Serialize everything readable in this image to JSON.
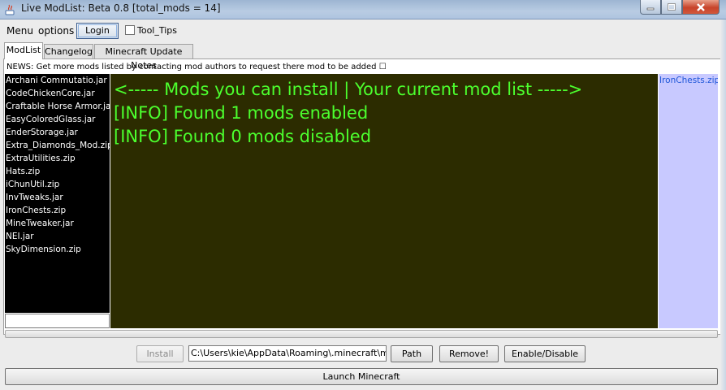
{
  "window": {
    "title": "Live ModList: Beta 0.8 [total_mods = 14]"
  },
  "menubar": {
    "menu_label": "Menu",
    "options_label": "options",
    "login_label": "Login",
    "tooltips_label": "Tool_Tips",
    "tooltips_checked": false
  },
  "tabs": [
    {
      "label": "ModList",
      "active": true
    },
    {
      "label": "Changelog",
      "active": false
    },
    {
      "label": "Minecraft Update Notes",
      "active": false
    }
  ],
  "news": {
    "text": "NEWS: Get more mods listed by contacting mod authors to request there mod to be added ☐"
  },
  "available_mods": [
    "Archani Commutatio.jar",
    "CodeChickenCore.jar",
    "Craftable Horse Armor.jar",
    "EasyColoredGlass.jar",
    "EnderStorage.jar",
    "Extra_Diamonds_Mod.zip",
    "ExtraUtilities.zip",
    "Hats.zip",
    "iChunUtil.zip",
    "InvTweaks.jar",
    "IronChests.zip",
    "MineTweaker.jar",
    "NEI.jar",
    "SkyDimension.zip"
  ],
  "filter_input": {
    "value": ""
  },
  "console": {
    "lines": [
      "<----- Mods you can install | Your current mod list ----->",
      "[INFO] Found 1 mods enabled",
      "[INFO] Found 0 mods disabled"
    ],
    "text_color": "#4cff2e",
    "background_color": "#2c2c00"
  },
  "installed_mods": [
    "IronChests.zip"
  ],
  "controls": {
    "install_label": "Install",
    "install_enabled": false,
    "path_value": "C:\\Users\\kie\\AppData\\Roaming\\.minecraft\\mods\\",
    "path_button_label": "Path",
    "remove_label": "Remove!",
    "toggle_label": "Enable/Disable",
    "launch_label": "Launch Minecraft"
  },
  "colors": {
    "mod_list_bg": "#000000",
    "installed_list_bg": "#c8c9ff",
    "installed_text": "#1d55d8",
    "close_button": "#c7432a"
  }
}
